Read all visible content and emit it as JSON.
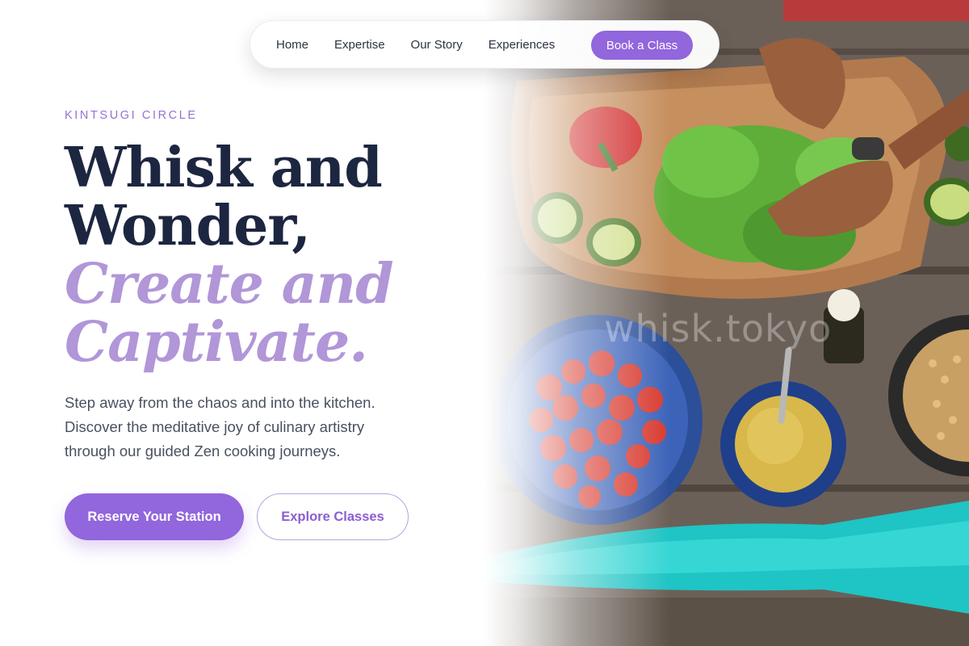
{
  "nav": {
    "links": [
      "Home",
      "Expertise",
      "Our Story",
      "Experiences"
    ],
    "cta_label": "Book a Class"
  },
  "hero": {
    "eyebrow": "KINTSUGI CIRCLE",
    "headline_lines": [
      "Whisk and",
      "Wonder,"
    ],
    "headline_accent_lines": [
      "Create and",
      "Captivate."
    ],
    "lede_lines": [
      "Step away from the chaos and into the kitchen.",
      "Discover the meditative joy of culinary artistry",
      "through our guided Zen cooking journeys."
    ],
    "primary_button_label": "Reserve Your Station",
    "secondary_button_label": "Explore Classes"
  },
  "photo": {
    "watermark": "whisk.tokyo"
  },
  "colors": {
    "accent": "#9266dc",
    "accent_light": "#b196d8",
    "heading": "#1d2640",
    "body_text": "#4a5060"
  }
}
